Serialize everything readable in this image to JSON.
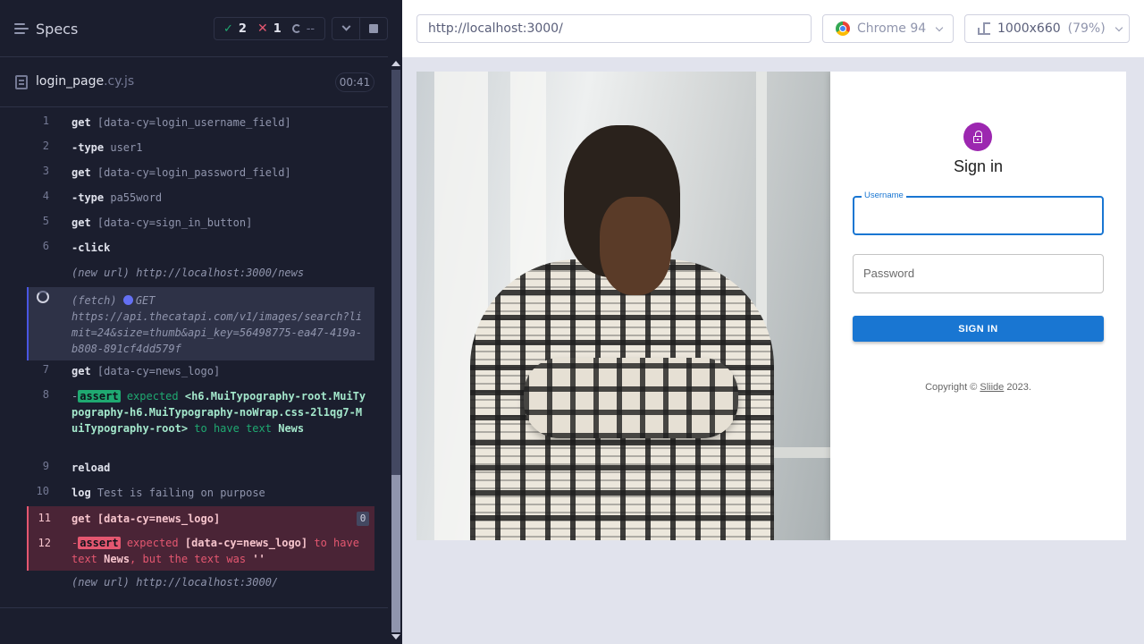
{
  "reporter": {
    "specs_label": "Specs",
    "stats": {
      "passed": "2",
      "failed": "1",
      "pending": "--"
    },
    "spec": {
      "name": "login_page",
      "ext": ".cy.js",
      "duration": "00:41"
    },
    "commands": [
      {
        "num": "1",
        "name": "get",
        "message": "[data-cy=login_username_field]"
      },
      {
        "num": "2",
        "name": "-type",
        "message": "user1"
      },
      {
        "num": "3",
        "name": "get",
        "message": "[data-cy=login_password_field]"
      },
      {
        "num": "4",
        "name": "-type",
        "message": "pa55word"
      },
      {
        "num": "5",
        "name": "get",
        "message": "[data-cy=sign_in_button]"
      },
      {
        "num": "6",
        "name": "-click",
        "message": ""
      },
      {
        "num": "",
        "name": "(new url)",
        "message": "http://localhost:3000/news"
      },
      {
        "num": "",
        "name": "(fetch)",
        "method": "GET",
        "message": "https://api.thecatapi.com/v1/images/search?limit=24&size=thumb&api_key=56498775-ea47-419a-b808-891cf4dd579f"
      },
      {
        "num": "7",
        "name": "get",
        "message": "[data-cy=news_logo]"
      },
      {
        "num": "8",
        "name": "assert",
        "expected": "expected",
        "element": "<h6.MuiTypography-root.MuiTypography-h6.MuiTypography-noWrap.css-2l1qg7-MuiTypography-root>",
        "to_have": "to have text",
        "text": "News"
      },
      {
        "num": "9",
        "name": "reload",
        "message": ""
      },
      {
        "num": "10",
        "name": "log",
        "message": "Test is failing on purpose"
      },
      {
        "num": "11",
        "name": "get",
        "message": "[data-cy=news_logo]",
        "count": "0"
      },
      {
        "num": "12",
        "name": "assert",
        "expected": "expected",
        "element": "[data-cy=news_logo]",
        "to_have": "to have text",
        "text": "News",
        "but": ", but the text was",
        "actual": "''"
      },
      {
        "num": "",
        "name": "(new url)",
        "message": "http://localhost:3000/"
      }
    ]
  },
  "aut": {
    "url": "http://localhost:3000/",
    "browser": "Chrome 94",
    "viewport": "1000x660",
    "viewport_pct": "(79%)",
    "login": {
      "title": "Sign in",
      "username_label": "Username",
      "password_placeholder": "Password",
      "button": "SIGN IN",
      "copyright_pre": "Copyright © ",
      "copyright_link": "Sliide",
      "copyright_post": " 2023."
    }
  },
  "colors": {
    "pass": "#1fa971",
    "fail": "#e45770",
    "accent": "#4956e3",
    "mui_primary": "#1976d2",
    "avatar": "#9c27b0"
  }
}
